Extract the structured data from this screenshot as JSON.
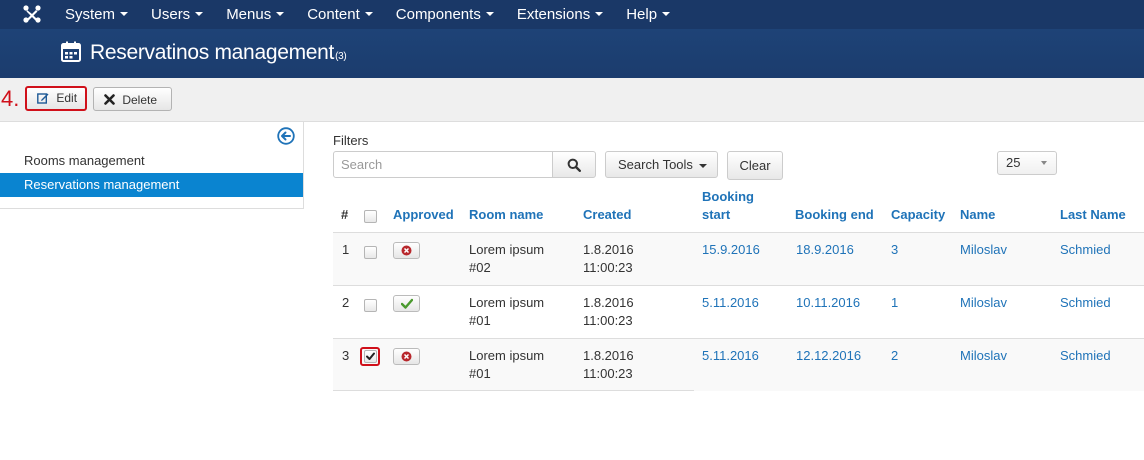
{
  "topnav": {
    "logo_icon": "joomla-logo-icon",
    "menu": [
      {
        "label": "System"
      },
      {
        "label": "Users"
      },
      {
        "label": "Menus"
      },
      {
        "label": "Content"
      },
      {
        "label": "Components"
      },
      {
        "label": "Extensions"
      },
      {
        "label": "Help"
      }
    ]
  },
  "header": {
    "title": "Reservatinos management",
    "count": "(3)",
    "icon": "calendar-icon"
  },
  "toolbar": {
    "step_label": "4.",
    "edit_label": "Edit",
    "delete_label": "Delete"
  },
  "sidebar": {
    "items": [
      {
        "label": "Rooms management",
        "active": false
      },
      {
        "label": "Reservations management",
        "active": true
      }
    ]
  },
  "filters": {
    "label": "Filters",
    "search_placeholder": "Search",
    "search_value": "",
    "search_tools_label": "Search Tools",
    "clear_label": "Clear",
    "limit_value": "25"
  },
  "table": {
    "headers": {
      "num": "#",
      "approved": "Approved",
      "room_name": "Room name",
      "created": "Created",
      "booking_start_1": "Booking",
      "booking_start_2": "start",
      "booking_end": "Booking end",
      "capacity": "Capacity",
      "name": "Name",
      "last_name": "Last Name"
    },
    "rows": [
      {
        "num": "1",
        "checked": false,
        "approved": false,
        "room_1": "Lorem ipsum",
        "room_2": "#02",
        "created_date": "1.8.2016",
        "created_time": "11:00:23",
        "booking_start": "15.9.2016",
        "booking_end": "18.9.2016",
        "capacity": "3",
        "name": "Miloslav",
        "last_name": "Schmied"
      },
      {
        "num": "2",
        "checked": false,
        "approved": true,
        "room_1": "Lorem ipsum",
        "room_2": "#01",
        "created_date": "1.8.2016",
        "created_time": "11:00:23",
        "booking_start": "5.11.2016",
        "booking_end": "10.11.2016",
        "capacity": "1",
        "name": "Miloslav",
        "last_name": "Schmied"
      },
      {
        "num": "3",
        "checked": true,
        "approved": false,
        "room_1": "Lorem ipsum",
        "room_2": "#01",
        "created_date": "1.8.2016",
        "created_time": "11:00:23",
        "booking_start": "5.11.2016",
        "booking_end": "12.12.2016",
        "capacity": "2",
        "name": "Miloslav",
        "last_name": "Schmied"
      }
    ]
  },
  "colors": {
    "topnav_bg": "#1a3867",
    "link": "#1f73b8",
    "active_sidebar": "#0a84d0",
    "highlight": "#d0101a",
    "approved_green": "#4a9a2e",
    "rejected_red": "#b8272c"
  }
}
